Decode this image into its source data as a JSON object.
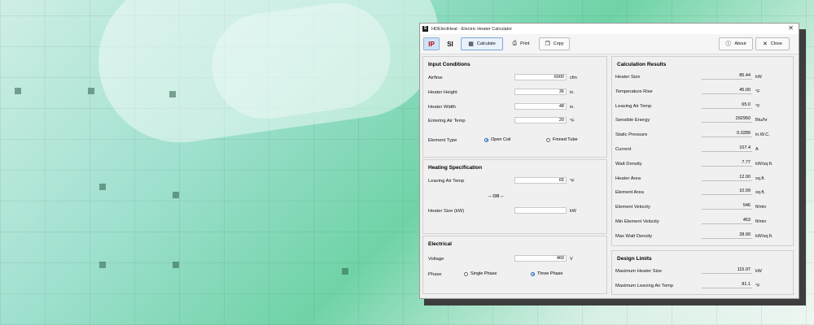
{
  "window": {
    "title": "HDElectHeat - Electric Heater Calculator"
  },
  "toolbar": {
    "ip_label": "IP",
    "si_label": "SI",
    "calculate_label": "Calculate",
    "print_label": "Print",
    "copy_label": "Copy",
    "about_label": "About",
    "close_label": "Close"
  },
  "input_conditions": {
    "title": "Input Conditions",
    "airflow": {
      "label": "Airflow",
      "value": "6000",
      "unit": "cfm"
    },
    "height": {
      "label": "Heater Height",
      "value": "36",
      "unit": "in."
    },
    "width": {
      "label": "Heater Width",
      "value": "48",
      "unit": "in."
    },
    "entering": {
      "label": "Entering Air Temp",
      "value": "20",
      "unit": "°F"
    },
    "element_type": {
      "label": "Element Type",
      "opt1": "Open Coil",
      "opt2": "Finned Tube"
    }
  },
  "heating_spec": {
    "title": "Heating Specification",
    "leaving": {
      "label": "Leaving Air Temp",
      "value": "65",
      "unit": "°F"
    },
    "or": "-- OR --",
    "size": {
      "label": "Heater Size (kW)",
      "value": "",
      "unit": "kW"
    }
  },
  "electrical": {
    "title": "Electrical",
    "voltage": {
      "label": "Voltage",
      "value": "460",
      "unit": "V"
    },
    "phase": {
      "label": "Phase",
      "opt1": "Single Phase",
      "opt2": "Three Phase"
    }
  },
  "results": {
    "title": "Calculation Results",
    "rows": [
      {
        "label": "Heater Size",
        "value": "85.44",
        "unit": "kW"
      },
      {
        "label": "Temperature Rise",
        "value": "45.00",
        "unit": "°F"
      },
      {
        "label": "Leaving Air Temp",
        "value": "65.0",
        "unit": "°F"
      },
      {
        "label": "Sensible Energy",
        "value": "292950",
        "unit": "Btu/hr"
      },
      {
        "label": "Static Pressure",
        "value": "0.0289",
        "unit": "in.W.C."
      },
      {
        "label": "Current",
        "value": "107.4",
        "unit": "A"
      },
      {
        "label": "Watt Density",
        "value": "7.77",
        "unit": "kW/sq.ft."
      },
      {
        "label": "Heater Area",
        "value": "12.00",
        "unit": "sq.ft."
      },
      {
        "label": "Element Area",
        "value": "10.99",
        "unit": "sq.ft."
      },
      {
        "label": "Element Velocity",
        "value": "546",
        "unit": "ft/min"
      },
      {
        "label": "Min Element Velocity",
        "value": "453",
        "unit": "ft/min"
      },
      {
        "label": "Max Watt Density",
        "value": "28.90",
        "unit": "kW/sq.ft."
      }
    ]
  },
  "design_limits": {
    "title": "Design Limits",
    "rows": [
      {
        "label": "Maximum Heater Size",
        "value": "115.97",
        "unit": "kW"
      },
      {
        "label": "Maximum Leaving Air Temp",
        "value": "81.1",
        "unit": "°F"
      }
    ]
  }
}
